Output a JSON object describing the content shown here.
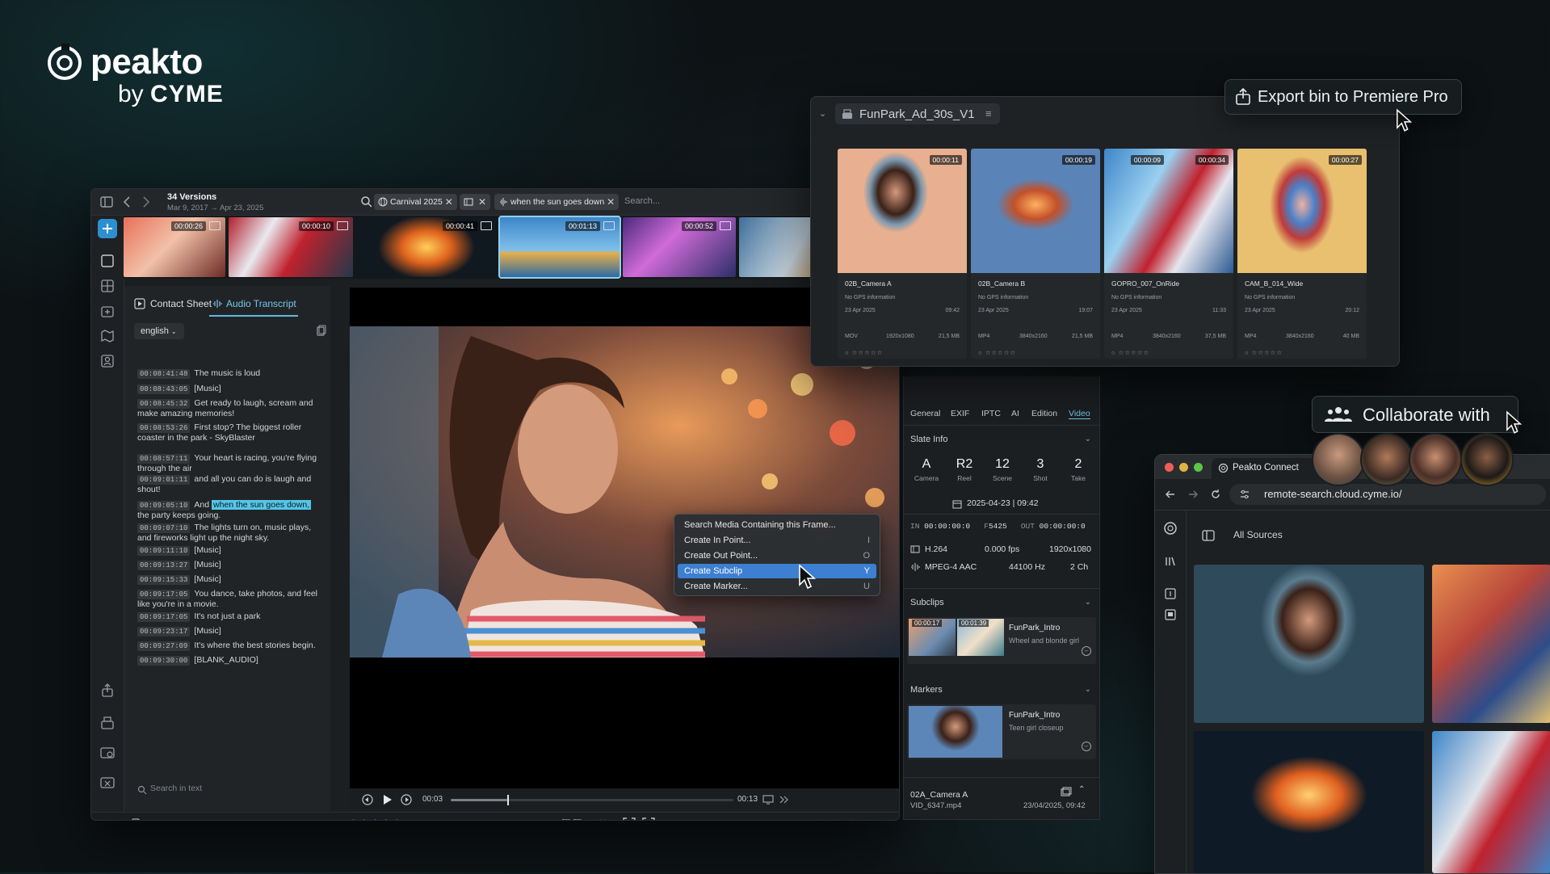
{
  "brand": {
    "word": "peakto",
    "by": "by",
    "company": "CYME"
  },
  "toolbar": {
    "versions_title": "34 Versions",
    "versions_dates": "Mar 9, 2017 → Apr 23, 2025",
    "chips": [
      "Carnival 2025",
      "when the sun goes down"
    ],
    "search_placeholder": "Search..."
  },
  "filmstrip": [
    "00:00:26",
    "00:00:10",
    "00:00:41",
    "00:01:13",
    "00:00:52"
  ],
  "left_panel": {
    "tabs": [
      "Contact Sheet",
      "Audio Transcript"
    ],
    "language": "english",
    "transcript": [
      {
        "ts": "00:08:41:48",
        "text": "The music is loud"
      },
      {
        "ts": "00:08:43:05",
        "text": "[Music]"
      },
      {
        "ts": "00:08:45:32",
        "text": "Get ready to laugh, scream and make amazing memories!"
      },
      {
        "ts": "00:08:53:26",
        "text": "First stop? The biggest roller coaster in the park - SkyBlaster"
      },
      {
        "ts": "00:08:57:11",
        "text": "Your heart is racing, you're flying through the air"
      },
      {
        "ts": "00:09:01:11",
        "text": "and all you can do is laugh and shout!"
      },
      {
        "ts": "00:09:05:10",
        "pre": "And ",
        "highlight": "when the sun goes down,",
        "post": " the party keeps going."
      },
      {
        "ts": "00:09:07:10",
        "text": "The lights turn on, music plays, and fireworks light up the night sky."
      },
      {
        "ts": "00:09:11:10",
        "text": "[Music]"
      },
      {
        "ts": "00:09:13:27",
        "text": "[Music]"
      },
      {
        "ts": "00:09:15:33",
        "text": "[Music]"
      },
      {
        "ts": "00:09:17:05",
        "text": "You dance, take photos, and feel like you're in a movie."
      },
      {
        "ts": "00:09:17:05",
        "text": "It's not just a park"
      },
      {
        "ts": "00:09:23:17",
        "text": "[Music]"
      },
      {
        "ts": "00:09:27:09",
        "text": "It's where the best stories begin."
      },
      {
        "ts": "00:09:30:00",
        "text": "[BLANK_AUDIO]"
      }
    ],
    "search_placeholder": "Search in text"
  },
  "transport": {
    "current": "00:03",
    "total": "00:13",
    "progress": 0.2
  },
  "context_menu": [
    {
      "label": "Search Media Containing this Frame...",
      "key": ""
    },
    {
      "label": "Create In Point...",
      "key": "I"
    },
    {
      "label": "Create Out Point...",
      "key": "O"
    },
    {
      "label": "Create Subclip",
      "key": "Y",
      "selected": true
    },
    {
      "label": "Create Marker...",
      "key": "U"
    }
  ],
  "inspector": {
    "tabs": [
      "General",
      "EXIF",
      "IPTC",
      "AI",
      "Edition",
      "Video"
    ],
    "slate_title": "Slate Info",
    "slate": [
      {
        "value": "A",
        "label": "Camera"
      },
      {
        "value": "R2",
        "label": "Reel"
      },
      {
        "value": "12",
        "label": "Scene"
      },
      {
        "value": "3",
        "label": "Shot"
      },
      {
        "value": "2",
        "label": "Take"
      }
    ],
    "datetime": "2025-04-23 | 09:42",
    "in_label": "IN",
    "in_tc": "00:00:00:0",
    "f_label": "F",
    "f_val": "5425",
    "out_label": "OUT",
    "out_tc": "00:00:00:0",
    "video_codec": "H.264",
    "fps": "0.000 fps",
    "resolution": "1920x1080",
    "audio_codec": "MPEG-4 AAC",
    "sample_rate": "44100 Hz",
    "channels": "2 Ch",
    "subclips_title": "Subclips",
    "subclip": {
      "start": "00:00:17",
      "end": "00:01:39",
      "name": "FunPark_Intro",
      "desc": "Wheel and blonde girl"
    },
    "markers_title": "Markers",
    "marker": {
      "name": "FunPark_Intro",
      "desc": "Teen girl closeup"
    },
    "file_camera": "02A_Camera A",
    "file_name": "VID_6347.mp4",
    "file_date": "23/04/2025, 09:42"
  },
  "bin": {
    "title": "FunPark_Ad_30s_V1",
    "cards": [
      {
        "dur": "00:00:11",
        "name": "02B_Camera A",
        "date": "23 Apr 2025",
        "time": "09:42",
        "fmt": "MOV",
        "res": "1920x1080",
        "size": "21,5 MB"
      },
      {
        "dur": "00:00:19",
        "name": "02B_Camera B",
        "date": "23 Apr 2025",
        "time": "19:07",
        "fmt": "MP4",
        "res": "3840x2160",
        "size": "21,5 MB"
      },
      {
        "dur": "00:00:34",
        "dur2": "00:00:09",
        "name": "GOPRO_007_OnRide",
        "date": "23 Apr 2025",
        "time": "11:33",
        "fmt": "MP4",
        "res": "3840x2160",
        "size": "37,5 MB"
      },
      {
        "dur": "00:00:27",
        "name": "CAM_B_014_Wide",
        "date": "23 Apr 2025",
        "time": "20:12",
        "fmt": "MP4",
        "res": "3840x2160",
        "size": "40 MB"
      }
    ],
    "gps_text": "No GPS information"
  },
  "export_label": "Export bin to Premiere Pro",
  "collab_label": "Collaborate with",
  "browser": {
    "tab_title": "Peakto Connect",
    "url": "remote-search.cloud.cyme.io/",
    "all_sources": "All Sources"
  }
}
